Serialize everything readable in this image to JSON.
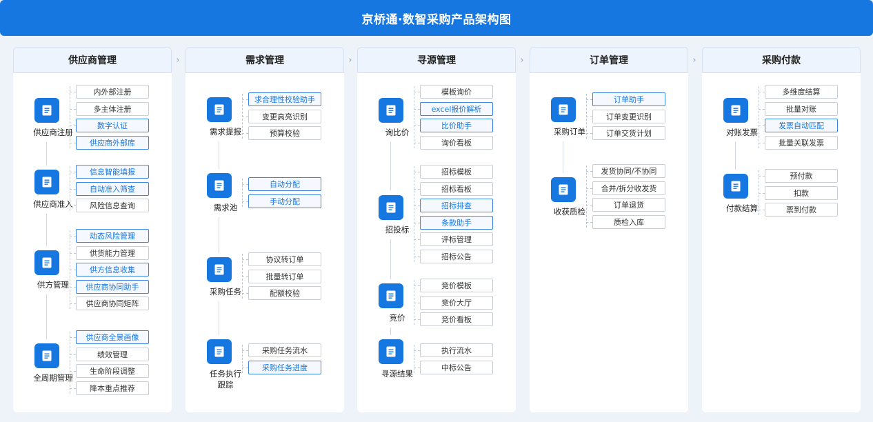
{
  "title": "京桥通·数智采购产品架构图",
  "columns": [
    {
      "title": "供应商管理",
      "groups": [
        {
          "label": "供应商注册",
          "items": [
            {
              "text": "内外部注册",
              "hl": false
            },
            {
              "text": "多主体注册",
              "hl": false
            },
            {
              "text": "数字认证",
              "hl": true
            },
            {
              "text": "供应商外部库",
              "hl": true
            }
          ]
        },
        {
          "label": "供应商准入",
          "items": [
            {
              "text": "信息智能填报",
              "hl": true
            },
            {
              "text": "自动准入筛查",
              "hl": true
            },
            {
              "text": "风险信息查询",
              "hl": false
            }
          ]
        },
        {
          "label": "供方管理",
          "items": [
            {
              "text": "动态风险管理",
              "hl": true
            },
            {
              "text": "供货能力管理",
              "hl": false
            },
            {
              "text": "供方信息收集",
              "hl": true
            },
            {
              "text": "供应商协同助手",
              "hl": true
            },
            {
              "text": "供应商协同矩阵",
              "hl": false
            }
          ]
        },
        {
          "label": "全周期管理",
          "items": [
            {
              "text": "供应商全景画像",
              "hl": true
            },
            {
              "text": "绩效管理",
              "hl": false
            },
            {
              "text": "生命阶段调整",
              "hl": false
            },
            {
              "text": "降本重点推荐",
              "hl": false
            }
          ]
        }
      ]
    },
    {
      "title": "需求管理",
      "groups": [
        {
          "label": "需求提报",
          "items": [
            {
              "text": "求合理性校验助手",
              "hl": true
            },
            {
              "text": "变更高亮识别",
              "hl": false
            },
            {
              "text": "预算校验",
              "hl": false
            }
          ]
        },
        {
          "label": "需求池",
          "items": [
            {
              "text": "自动分配",
              "hl": true
            },
            {
              "text": "手动分配",
              "hl": true
            }
          ]
        },
        {
          "label": "采购任务",
          "items": [
            {
              "text": "协议转订单",
              "hl": false
            },
            {
              "text": "批量转订单",
              "hl": false
            },
            {
              "text": "配额校验",
              "hl": false
            }
          ]
        },
        {
          "label": "任务执行\n跟踪",
          "items": [
            {
              "text": "采购任务流水",
              "hl": false
            },
            {
              "text": "采购任务进度",
              "hl": true
            }
          ]
        }
      ]
    },
    {
      "title": "寻源管理",
      "groups": [
        {
          "label": "询比价",
          "items": [
            {
              "text": "模板询价",
              "hl": false
            },
            {
              "text": "excel报价解析",
              "hl": true
            },
            {
              "text": "比价助手",
              "hl": true
            },
            {
              "text": "询价看板",
              "hl": false
            }
          ]
        },
        {
          "label": "招投标",
          "items": [
            {
              "text": "招标模板",
              "hl": false
            },
            {
              "text": "招标看板",
              "hl": false
            },
            {
              "text": "招标排查",
              "hl": true
            },
            {
              "text": "条款助手",
              "hl": true
            },
            {
              "text": "评标管理",
              "hl": false
            },
            {
              "text": "招标公告",
              "hl": false
            }
          ]
        },
        {
          "label": "竞价",
          "items": [
            {
              "text": "竞价模板",
              "hl": false
            },
            {
              "text": "竞价大厅",
              "hl": false
            },
            {
              "text": "竞价看板",
              "hl": false
            }
          ]
        },
        {
          "label": "寻源结果",
          "items": [
            {
              "text": "执行流水",
              "hl": false
            },
            {
              "text": "中标公告",
              "hl": false
            }
          ]
        }
      ]
    },
    {
      "title": "订单管理",
      "groups": [
        {
          "label": "采购订单",
          "items": [
            {
              "text": "订单助手",
              "hl": true
            },
            {
              "text": "订单变更识别",
              "hl": false
            },
            {
              "text": "订单交货计划",
              "hl": false
            }
          ]
        },
        {
          "label": "收获质检",
          "items": [
            {
              "text": "发货协同/不协同",
              "hl": false
            },
            {
              "text": "合并/拆分收发货",
              "hl": false
            },
            {
              "text": "订单退货",
              "hl": false
            },
            {
              "text": "质检入库",
              "hl": false
            }
          ]
        }
      ]
    },
    {
      "title": "采购付款",
      "groups": [
        {
          "label": "对账发票",
          "items": [
            {
              "text": "多维度结算",
              "hl": false
            },
            {
              "text": "批量对账",
              "hl": false
            },
            {
              "text": "发票自动匹配",
              "hl": true
            },
            {
              "text": "批量关联发票",
              "hl": false
            }
          ]
        },
        {
          "label": "付款结算",
          "items": [
            {
              "text": "预付款",
              "hl": false
            },
            {
              "text": "扣款",
              "hl": false
            },
            {
              "text": "票到付款",
              "hl": false
            }
          ]
        }
      ]
    }
  ],
  "icon": "document-icon",
  "colors": {
    "accent": "#1677e0",
    "highlight_border": "#3a86e0",
    "background": "#eef3fa"
  }
}
